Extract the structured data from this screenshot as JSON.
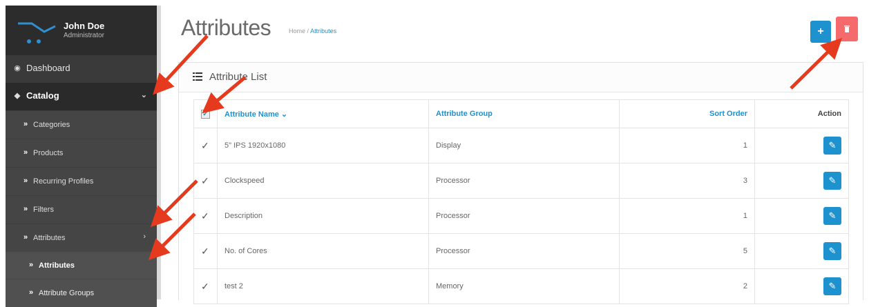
{
  "user": {
    "name": "John Doe",
    "role": "Administrator"
  },
  "sidebar": {
    "items": [
      {
        "label": "Dashboard",
        "icon": "dashboard-icon"
      },
      {
        "label": "Catalog",
        "icon": "tag-icon",
        "active": true
      }
    ],
    "catalog_sub": [
      {
        "label": "Categories"
      },
      {
        "label": "Products"
      },
      {
        "label": "Recurring Profiles"
      },
      {
        "label": "Filters"
      },
      {
        "label": "Attributes"
      }
    ],
    "attributes_sub": [
      {
        "label": "Attributes",
        "active": true
      },
      {
        "label": "Attribute Groups"
      }
    ]
  },
  "header": {
    "title": "Attributes",
    "breadcrumb_home": "Home",
    "breadcrumb_sep": "/",
    "breadcrumb_current": "Attributes",
    "add_icon": "plus-icon",
    "delete_icon": "trash-icon"
  },
  "panel": {
    "title": "Attribute List"
  },
  "table": {
    "columns": {
      "name": "Attribute Name",
      "group": "Attribute Group",
      "sort": "Sort Order",
      "action": "Action"
    },
    "rows": [
      {
        "name": "5\" IPS 1920x1080",
        "group": "Display",
        "sort": "1"
      },
      {
        "name": "Clockspeed",
        "group": "Processor",
        "sort": "3"
      },
      {
        "name": "Description",
        "group": "Processor",
        "sort": "1"
      },
      {
        "name": "No. of Cores",
        "group": "Processor",
        "sort": "5"
      },
      {
        "name": "test 2",
        "group": "Memory",
        "sort": "2"
      }
    ]
  },
  "colors": {
    "accent": "#1e91cf",
    "danger": "#f56b6b",
    "annotation": "#e53a1e",
    "sidebar": "#3a3a3a"
  }
}
